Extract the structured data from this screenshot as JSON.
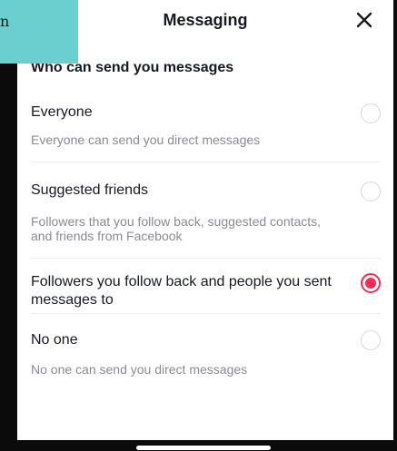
{
  "overlay": {
    "text": "n"
  },
  "header": {
    "title": "Messaging",
    "close_icon": "close-icon"
  },
  "section": {
    "title": "Who can send you messages"
  },
  "options": [
    {
      "label": "Everyone",
      "description": "Everyone can send you direct messages",
      "selected": false
    },
    {
      "label": "Suggested friends",
      "description": "Followers that you follow back, suggested contacts, and friends from Facebook",
      "selected": false
    },
    {
      "label": "Followers you follow back and people you sent messages to",
      "description": "",
      "selected": true
    },
    {
      "label": "No one",
      "description": "No one can send you direct messages",
      "selected": false
    }
  ],
  "colors": {
    "accent": "#fe2c55",
    "text": "#161823",
    "secondary_text": "#8a8b91",
    "overlay": "#6ccfcf"
  }
}
